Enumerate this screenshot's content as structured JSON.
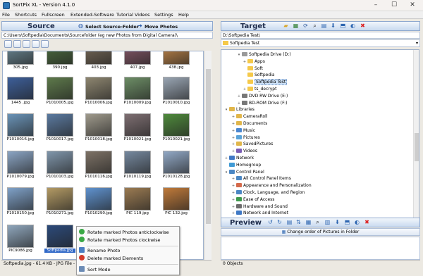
{
  "window": {
    "title": "SortPix XL - Version 4.1.0",
    "minimize": "–",
    "maximize": "☐",
    "close": "✕"
  },
  "menu": [
    "File",
    "Shortcuts",
    "Fullscreen",
    "Extended-Software",
    "Tutorial Videos",
    "Settings",
    "Help"
  ],
  "source": {
    "title": "Source",
    "select_folder": "Select Source-Folder",
    "move_photos": "Move Photos",
    "path": "C:\\Users\\Softpedia\\Documents\\Sourcefolder (eg new Photos from Digital Camera)\\",
    "thumbnails": [
      {
        "name": "305.jpg",
        "color": "#6f8d9a"
      },
      {
        "name": "390.jpg",
        "color": "#4d6e3f"
      },
      {
        "name": "403.jpg",
        "color": "#7a6c5a"
      },
      {
        "name": "407.jpg",
        "color": "#8b5a6b"
      },
      {
        "name": "438.jpg",
        "color": "#c88a4a"
      },
      {
        "name": "1445 .jpg",
        "color": "#3d5f9a"
      },
      {
        "name": "P1010005.jpg",
        "color": "#5e7a4b"
      },
      {
        "name": "P1010006.jpg",
        "color": "#8e8670"
      },
      {
        "name": "P1010009.jpg",
        "color": "#6d8e66"
      },
      {
        "name": "P1010010.jpg",
        "color": "#9aa6b4"
      },
      {
        "name": "P1010016.jpg",
        "color": "#6a93b7"
      },
      {
        "name": "P1010017.jpg",
        "color": "#5b7aa0"
      },
      {
        "name": "P1010018.jpg",
        "color": "#9f9a8c"
      },
      {
        "name": "P1010021.jpg",
        "color": "#7e6f72"
      },
      {
        "name": "P1010021.jpg",
        "color": "#4f8a3c"
      },
      {
        "name": "P1010079.jpg",
        "color": "#8ba5c4"
      },
      {
        "name": "P1010103.jpg",
        "color": "#8096ab"
      },
      {
        "name": "P1010116.jpg",
        "color": "#7d7266"
      },
      {
        "name": "P1010119.jpg",
        "color": "#76899f"
      },
      {
        "name": "P1010128.jpg",
        "color": "#92a9c6"
      },
      {
        "name": "P1010150.jpg",
        "color": "#7fa1c8"
      },
      {
        "name": "P1010271.jpg",
        "color": "#b39a64"
      },
      {
        "name": "P1010290.jpg",
        "color": "#5f92cf"
      },
      {
        "name": "PIC 119.jpg",
        "color": "#9b7b52"
      },
      {
        "name": "PIC 132.jpg",
        "color": "#c07a3a"
      },
      {
        "name": "PIC9086.jpg",
        "color": "#8fa6bc"
      },
      {
        "name": "Softpedia.jpg",
        "color": "#2c4a7a"
      }
    ],
    "status": "Softpedia.jpg - 61.4 KB - JPG File - P"
  },
  "context_menu": {
    "items": [
      {
        "label": "Rotate marked Photos anticlockwise",
        "color": "#39a845"
      },
      {
        "label": "Rotate marked Photos clockwise",
        "color": "#39a845"
      },
      {
        "label": "Rename Photo",
        "color": "#4a7ec2"
      },
      {
        "label": "Delete marked Elements",
        "color": "#d33a2a"
      },
      {
        "label": "Sort Mode",
        "color": "#6b8bb5"
      }
    ]
  },
  "target": {
    "title": "Target",
    "path": "D:\\Softpedia Test\\",
    "dropdown": "Softpedia Test",
    "tree": [
      {
        "label": "Softpedia Drive (D:)",
        "level": 2,
        "expand": "▾",
        "color": "#9a9a9a"
      },
      {
        "label": "Apps",
        "level": 3,
        "expand": "+",
        "color": "#f5c94a"
      },
      {
        "label": "Soft",
        "level": 3,
        "expand": "",
        "color": "#f5c94a"
      },
      {
        "label": "Softpedia",
        "level": 3,
        "expand": "",
        "color": "#f5c94a"
      },
      {
        "label": "Softpedia Test",
        "level": 3,
        "expand": "",
        "color": "#f5c94a",
        "selected": true
      },
      {
        "label": "ts_decrypt",
        "level": 3,
        "expand": "+",
        "color": "#f5c94a"
      },
      {
        "label": "DVD RW Drive (E:)",
        "level": 2,
        "expand": "+",
        "color": "#777"
      },
      {
        "label": "BD-ROM Drive (F:)",
        "level": 2,
        "expand": "+",
        "color": "#777"
      },
      {
        "label": "Libraries",
        "level": 0,
        "expand": "▾",
        "color": "#e1b64a"
      },
      {
        "label": "CameraRoll",
        "level": 1,
        "expand": "+",
        "color": "#e1b64a"
      },
      {
        "label": "Documents",
        "level": 1,
        "expand": "+",
        "color": "#e1b64a"
      },
      {
        "label": "Music",
        "level": 1,
        "expand": "+",
        "color": "#4a86d0"
      },
      {
        "label": "Pictures",
        "level": 1,
        "expand": "+",
        "color": "#5aa3d8"
      },
      {
        "label": "SavedPictures",
        "level": 1,
        "expand": "+",
        "color": "#e1b64a"
      },
      {
        "label": "Videos",
        "level": 1,
        "expand": "+",
        "color": "#7a5cb4"
      },
      {
        "label": "Network",
        "level": 0,
        "expand": "+",
        "color": "#3f78c5"
      },
      {
        "label": "Homegroup",
        "level": 0,
        "expand": "",
        "color": "#3f9ad5"
      },
      {
        "label": "Control Panel",
        "level": 0,
        "expand": "▾",
        "color": "#4b87c4"
      },
      {
        "label": "All Control Panel Items",
        "level": 1,
        "expand": "+",
        "color": "#4b87c4"
      },
      {
        "label": "Appearance and Personalization",
        "level": 1,
        "expand": "+",
        "color": "#d4694a"
      },
      {
        "label": "Clock, Language, and Region",
        "level": 1,
        "expand": "+",
        "color": "#4b87c4"
      },
      {
        "label": "Ease of Access",
        "level": 1,
        "expand": "+",
        "color": "#3e9a4c"
      },
      {
        "label": "Hardware and Sound",
        "level": 1,
        "expand": "+",
        "color": "#6c6c6c"
      },
      {
        "label": "Network and Internet",
        "level": 1,
        "expand": "+",
        "color": "#3e78c5"
      }
    ]
  },
  "preview": {
    "title": "Preview",
    "change_order": "Change order of Pictures in Folder",
    "status": "0 Objects"
  }
}
